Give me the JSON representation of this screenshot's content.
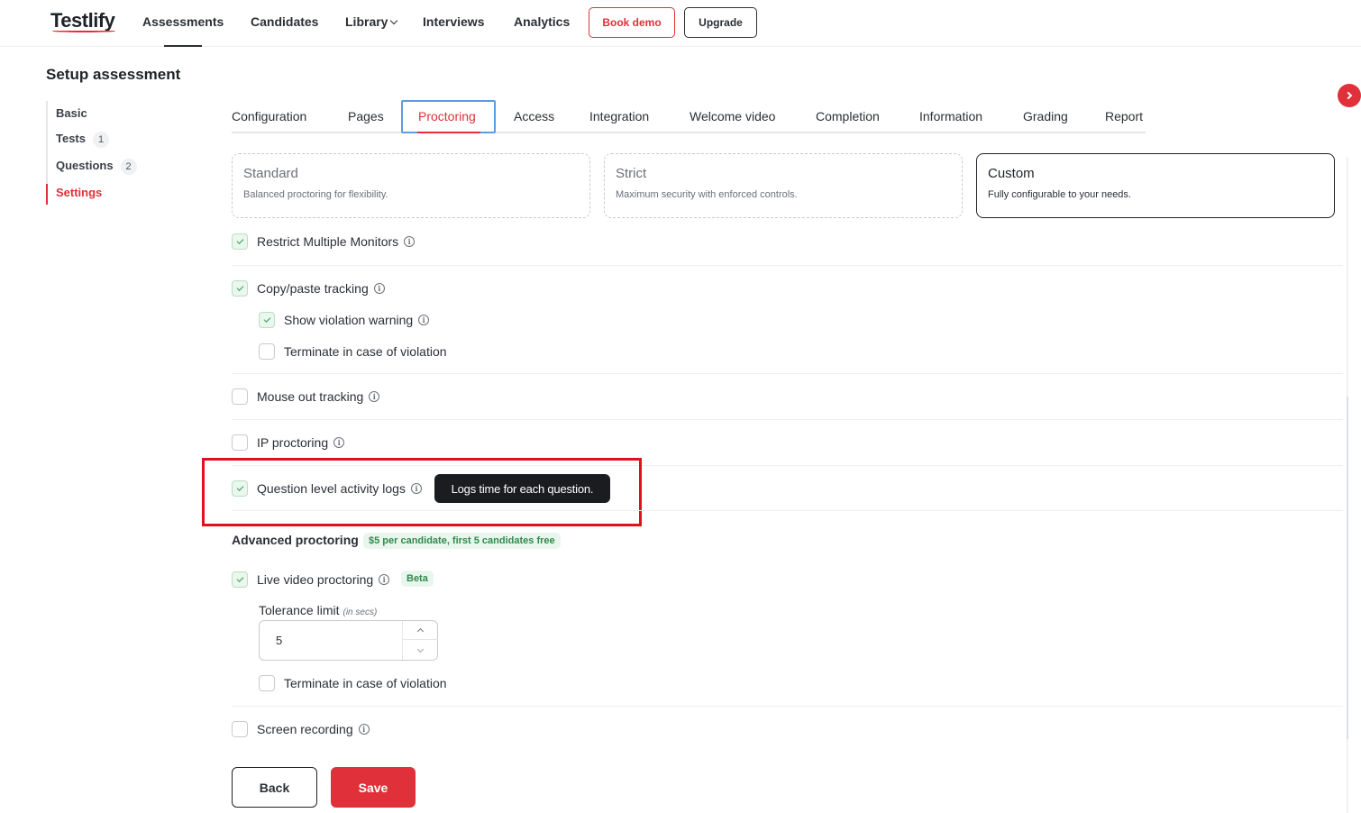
{
  "brand": {
    "name": "Testlify",
    "accent": "#e0303a"
  },
  "nav": {
    "items": [
      {
        "label": "Assessments"
      },
      {
        "label": "Candidates"
      },
      {
        "label": "Library"
      },
      {
        "label": "Interviews"
      },
      {
        "label": "Analytics"
      }
    ],
    "book_demo": "Book demo",
    "upgrade": "Upgrade"
  },
  "page_title": "Setup assessment",
  "steps": [
    {
      "label": "Basic"
    },
    {
      "label": "Tests",
      "count": "1"
    },
    {
      "label": "Questions",
      "count": "2"
    },
    {
      "label": "Settings"
    }
  ],
  "tabs": [
    {
      "label": "Configuration"
    },
    {
      "label": "Pages"
    },
    {
      "label": "Proctoring"
    },
    {
      "label": "Access"
    },
    {
      "label": "Integration"
    },
    {
      "label": "Welcome video"
    },
    {
      "label": "Completion"
    },
    {
      "label": "Information"
    },
    {
      "label": "Grading"
    },
    {
      "label": "Report"
    }
  ],
  "modes": [
    {
      "title": "Standard",
      "desc": "Balanced proctoring for flexibility."
    },
    {
      "title": "Strict",
      "desc": "Maximum security with enforced controls."
    },
    {
      "title": "Custom",
      "desc": "Fully configurable to your needs."
    }
  ],
  "options": {
    "restrict_monitors": {
      "label": "Restrict Multiple Monitors",
      "checked": true
    },
    "copy_paste": {
      "label": "Copy/paste tracking",
      "checked": true
    },
    "cp_warning": {
      "label": "Show violation warning",
      "checked": true
    },
    "cp_terminate": {
      "label": "Terminate in case of violation",
      "checked": false
    },
    "mouse_out": {
      "label": "Mouse out tracking",
      "checked": false
    },
    "ip": {
      "label": "IP proctoring",
      "checked": false
    },
    "qlogs": {
      "label": "Question level activity logs",
      "checked": true,
      "tooltip": "Logs time for each question."
    },
    "live_video": {
      "label": "Live video proctoring",
      "checked": true,
      "badge": "Beta"
    },
    "lv_terminate": {
      "label": "Terminate in case of violation",
      "checked": false
    },
    "screen_rec": {
      "label": "Screen recording",
      "checked": false
    }
  },
  "advanced": {
    "title": "Advanced proctoring",
    "price": "$5 per candidate, first 5 candidates free"
  },
  "tolerance": {
    "label": "Tolerance limit",
    "unit": "(in secs)",
    "value": "5"
  },
  "actions": {
    "back": "Back",
    "save": "Save"
  }
}
